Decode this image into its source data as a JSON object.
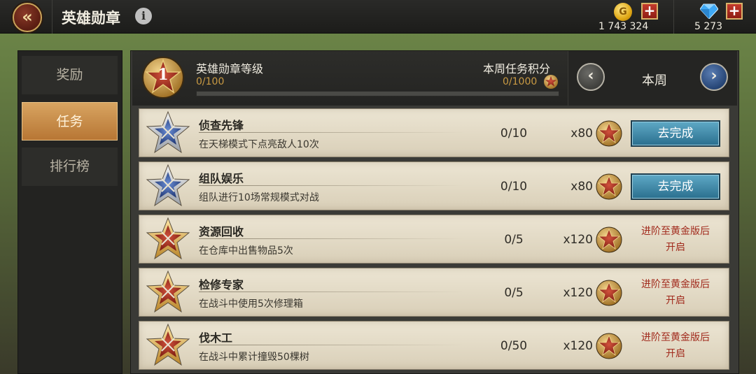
{
  "header": {
    "title": "英雄勋章",
    "info_icon": "info-icon",
    "back_icon": "double-chevron-left-icon",
    "gold": "1 743 324",
    "diamonds": "5 273",
    "plus": "+"
  },
  "sidebar": {
    "items": [
      {
        "label": "奖励",
        "active": false
      },
      {
        "label": "任务",
        "active": true
      },
      {
        "label": "排行榜",
        "active": false
      }
    ]
  },
  "medal": {
    "level": "1",
    "title": "英雄勋章等级",
    "progress": "0/100",
    "progress_fraction": 0,
    "weekly_title": "本周任务积分",
    "weekly_progress": "0/1000"
  },
  "week_selector": {
    "label": "本周"
  },
  "tasks": [
    {
      "name": "侦查先锋",
      "desc": "在天梯模式下点亮敌人10次",
      "progress": "0/10",
      "reward": "x80",
      "tier": "blue",
      "action": "去完成",
      "locked": false
    },
    {
      "name": "组队娱乐",
      "desc": "组队进行10场常规模式对战",
      "progress": "0/10",
      "reward": "x80",
      "tier": "blue",
      "action": "去完成",
      "locked": false
    },
    {
      "name": "资源回收",
      "desc": "在仓库中出售物品5次",
      "progress": "0/5",
      "reward": "x120",
      "tier": "gold",
      "locked_line1": "进阶至黄金版后",
      "locked_line2": "开启",
      "locked": true
    },
    {
      "name": "检修专家",
      "desc": "在战斗中使用5次修理箱",
      "progress": "0/5",
      "reward": "x120",
      "tier": "gold",
      "locked_line1": "进阶至黄金版后",
      "locked_line2": "开启",
      "locked": true
    },
    {
      "name": "伐木工",
      "desc": "在战斗中累计撞毁50棵树",
      "progress": "0/50",
      "reward": "x120",
      "tier": "gold",
      "locked_line1": "进阶至黄金版后",
      "locked_line2": "开启",
      "locked": true
    }
  ],
  "colors": {
    "accent_gold": "#c99a43",
    "locked_red": "#a12a1c",
    "go_button_blue": "#2a6f8e"
  }
}
